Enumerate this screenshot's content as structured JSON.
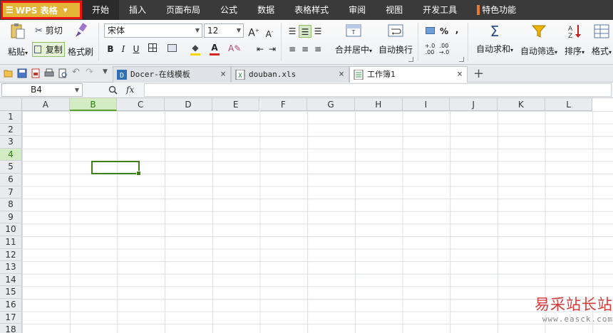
{
  "menubar": {
    "app_name": "WPS 表格",
    "tabs": [
      "开始",
      "插入",
      "页面布局",
      "公式",
      "数据",
      "表格样式",
      "审阅",
      "视图",
      "开发工具",
      "特色功能"
    ],
    "active_tab": "开始"
  },
  "ribbon": {
    "clipboard": {
      "paste": "粘贴",
      "cut": "剪切",
      "copy": "复制",
      "format_painter": "格式刷"
    },
    "font": {
      "name": "宋体",
      "size": "12",
      "bold": "B",
      "italic": "I",
      "underline": "U"
    },
    "alignment": {
      "merge_center": "合并居中",
      "wrap_text": "自动换行"
    },
    "number": {
      "percent": "%",
      "comma": ","
    },
    "editing": {
      "autosum": "自动求和",
      "autofilter": "自动筛选",
      "sort": "排序",
      "format": "格式"
    },
    "colors": {
      "fill": "#f6d600",
      "font": "#d8261b"
    }
  },
  "doc_tabs": [
    {
      "name": "Docer-在线模板",
      "active": false,
      "icon": "docer-icon"
    },
    {
      "name": "douban.xls",
      "active": false,
      "icon": "xls-file-icon"
    },
    {
      "name": "工作簿1",
      "active": true,
      "icon": "workbook-icon"
    }
  ],
  "formula_bar": {
    "cell_ref": "B4",
    "fx": "fx",
    "value": ""
  },
  "grid": {
    "columns": [
      "A",
      "B",
      "C",
      "D",
      "E",
      "F",
      "G",
      "H",
      "I",
      "J",
      "K",
      "L"
    ],
    "rows": [
      "1",
      "2",
      "3",
      "4",
      "5",
      "6",
      "7",
      "8",
      "9",
      "10",
      "11",
      "12",
      "13",
      "14",
      "15",
      "16",
      "17",
      "18"
    ],
    "selected_column": "B",
    "selected_row": "4"
  },
  "watermark": {
    "text": "易采站长站",
    "url": "www.easck.com"
  }
}
